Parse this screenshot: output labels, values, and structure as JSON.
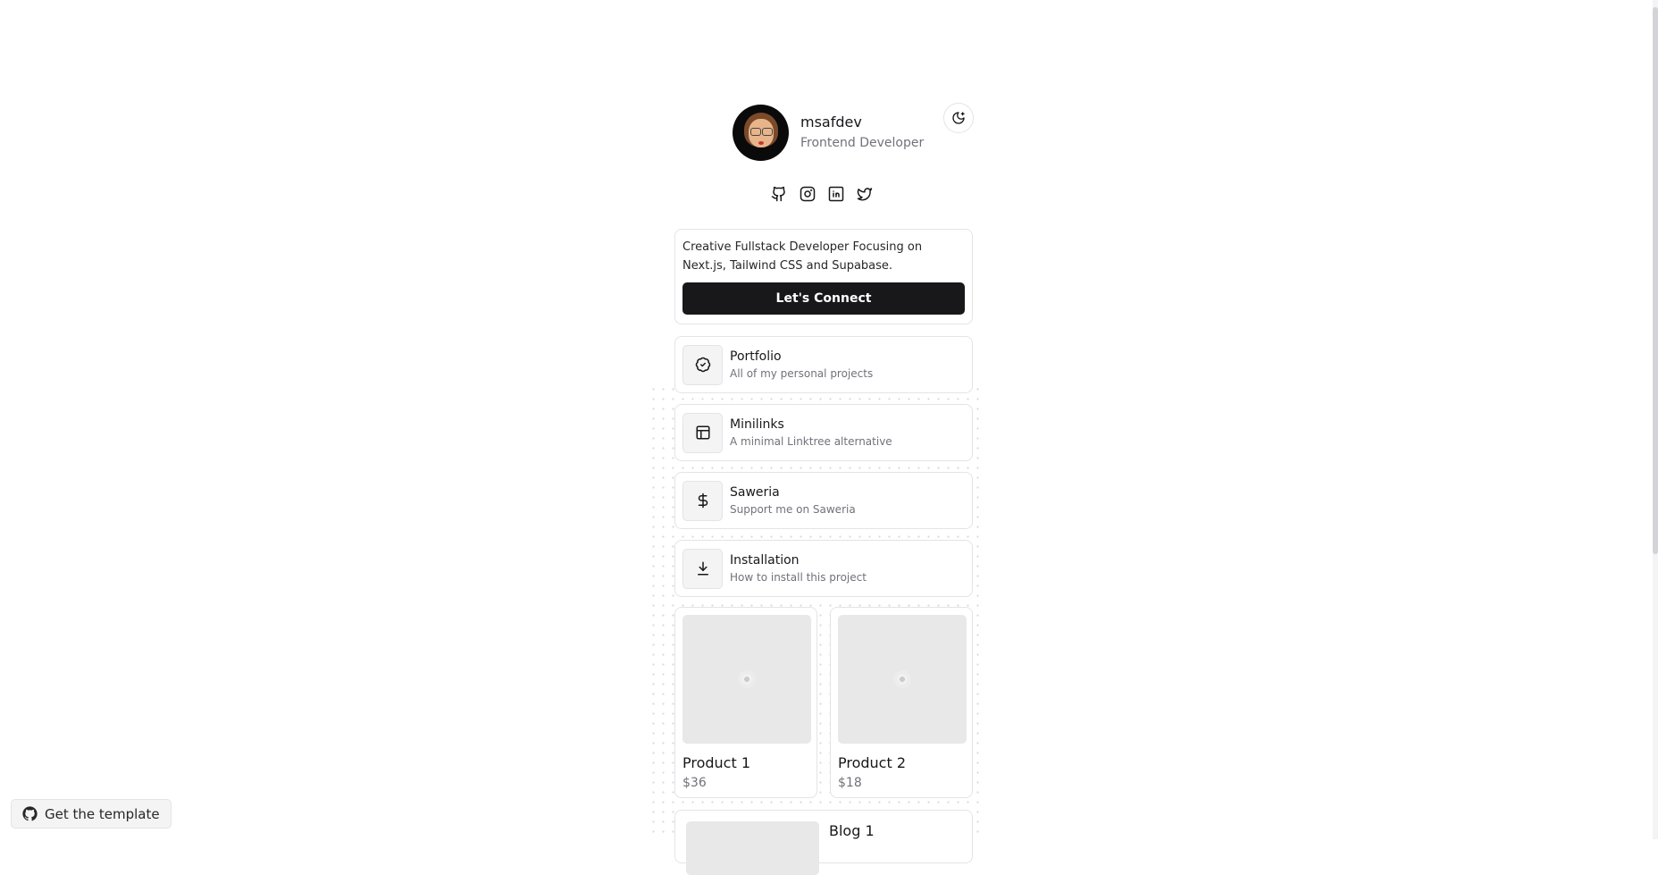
{
  "profile": {
    "name": "msafdev",
    "role": "Frontend Developer"
  },
  "socials": [
    "github-icon",
    "instagram-icon",
    "linkedin-icon",
    "twitter-icon"
  ],
  "intro": {
    "text": "Creative Fullstack Developer Focusing on Next.js, Tailwind CSS and Supabase.",
    "cta_label": "Let's Connect"
  },
  "links": [
    {
      "title": "Portfolio",
      "subtitle": "All of my personal projects",
      "icon": "badge-check-icon"
    },
    {
      "title": "Minilinks",
      "subtitle": "A minimal Linktree alternative",
      "icon": "layout-icon"
    },
    {
      "title": "Saweria",
      "subtitle": "Support me on Saweria",
      "icon": "dollar-icon"
    },
    {
      "title": "Installation",
      "subtitle": "How to install this project",
      "icon": "download-icon"
    }
  ],
  "products": [
    {
      "name": "Product 1",
      "price": "$36"
    },
    {
      "name": "Product 2",
      "price": "$18"
    }
  ],
  "blog": {
    "title": "Blog 1"
  },
  "footer": {
    "template_label": "Get the template"
  },
  "colors": {
    "primary": "#18181b",
    "muted": "#71717a",
    "border": "#e4e4e7",
    "surface": "#f4f4f5"
  }
}
